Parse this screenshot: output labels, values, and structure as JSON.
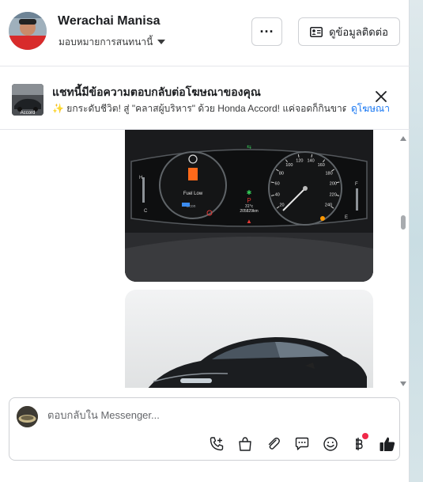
{
  "header": {
    "contact_name": "Werachai Manisa",
    "assign_label": "มอบหมายการสนทนานี้",
    "more_label": "···",
    "contact_info_label": "ดูข้อมูลติดต่อ"
  },
  "ad_banner": {
    "thumb_caption": "Accord",
    "title": "แชทนี้มีข้อความตอบกลับต่อโฆษณาของคุณ",
    "text": "ยกระดับชีวิต! สู่ \"คลาสผู้บริหาร\" ด้วย Honda Accord! แค่จอดก็กินขาด!...",
    "link_label": "ดูโฆษณา",
    "sparkle_icon": "✨"
  },
  "conversation": {
    "dashboard": {
      "fuel_warning": "Fuel Low",
      "odometer": "205829km",
      "trip_label": "Econ",
      "temperature": "31°c",
      "gear": "P",
      "speed_ticks": [
        "20",
        "40",
        "60",
        "80",
        "100",
        "120",
        "140",
        "160",
        "180",
        "200",
        "220",
        "240"
      ]
    }
  },
  "composer": {
    "placeholder": "ตอบกลับใน Messenger..."
  },
  "colors": {
    "accent": "#1877f2",
    "like": "#1c1e21",
    "notification_dot": "#f02849"
  },
  "icons": [
    "phone-plus-icon",
    "shopping-bag-icon",
    "paperclip-icon",
    "chat-bubble-icon",
    "emoji-icon",
    "baht-icon",
    "thumbs-up-icon"
  ]
}
